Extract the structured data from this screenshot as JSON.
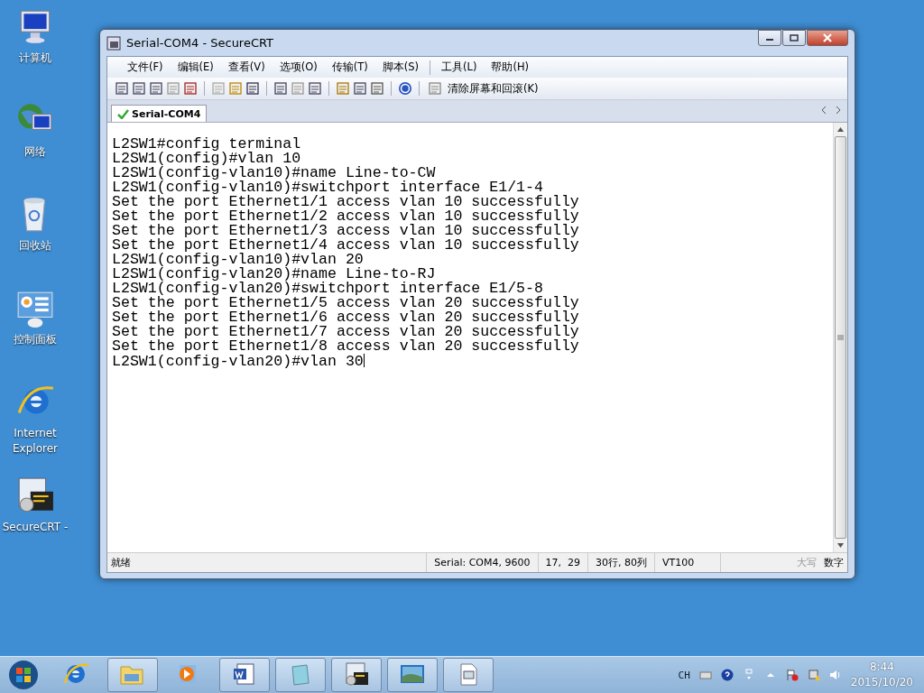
{
  "desktop_icons": [
    {
      "label": "计算机",
      "kind": "computer"
    },
    {
      "label": "网络",
      "kind": "network"
    },
    {
      "label": "回收站",
      "kind": "recycle"
    },
    {
      "label": "控制面板",
      "kind": "control"
    },
    {
      "label": "Internet Explorer",
      "kind": "ie"
    },
    {
      "label": "SecureCRT -",
      "kind": "crt"
    }
  ],
  "window": {
    "title": "Serial-COM4 - SecureCRT"
  },
  "menu": [
    "文件(F)",
    "编辑(E)",
    "查看(V)",
    "选项(O)",
    "传输(T)",
    "脚本(S)",
    "工具(L)",
    "帮助(H)"
  ],
  "toolbar": {
    "clear_button": "清除屏幕和回滚(K)"
  },
  "tabs": [
    {
      "label": "Serial-COM4",
      "selected": true
    }
  ],
  "terminal": {
    "lines": [
      "L2SW1#config terminal",
      "L2SW1(config)#vlan 10",
      "L2SW1(config-vlan10)#name Line-to-CW",
      "L2SW1(config-vlan10)#switchport interface E1/1-4",
      "Set the port Ethernet1/1 access vlan 10 successfully",
      "Set the port Ethernet1/2 access vlan 10 successfully",
      "Set the port Ethernet1/3 access vlan 10 successfully",
      "Set the port Ethernet1/4 access vlan 10 successfully",
      "L2SW1(config-vlan10)#vlan 20",
      "L2SW1(config-vlan20)#name Line-to-RJ",
      "L2SW1(config-vlan20)#switchport interface E1/5-8",
      "Set the port Ethernet1/5 access vlan 20 successfully",
      "Set the port Ethernet1/6 access vlan 20 successfully",
      "Set the port Ethernet1/7 access vlan 20 successfully",
      "Set the port Ethernet1/8 access vlan 20 successfully",
      "L2SW1(config-vlan20)#vlan 30"
    ]
  },
  "status_bar": {
    "message": "就绪",
    "connection": "Serial: COM4, 9600",
    "cursor": "17,  29",
    "size": "30行, 80列",
    "emulation": "VT100",
    "indicators": [
      {
        "label": "大写",
        "on": false
      },
      {
        "label": "数字",
        "on": true
      }
    ]
  },
  "taskbar": {
    "tasks": [
      {
        "kind": "ie",
        "open": false
      },
      {
        "kind": "folder",
        "open": true
      },
      {
        "kind": "media",
        "open": false
      },
      {
        "kind": "word",
        "open": true
      },
      {
        "kind": "notepad",
        "open": true
      },
      {
        "kind": "crt",
        "open": true
      },
      {
        "kind": "photo",
        "open": true
      },
      {
        "kind": "doc",
        "open": true
      }
    ],
    "language": "CH",
    "time": "8:44",
    "date": "2015/10/20"
  }
}
